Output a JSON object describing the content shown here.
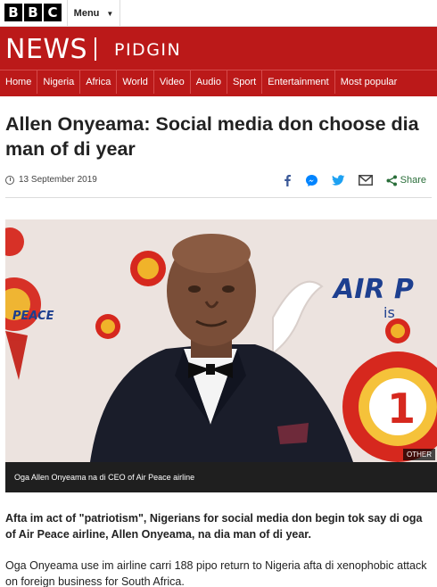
{
  "header": {
    "bbc_letters": [
      "B",
      "B",
      "C"
    ],
    "menu_label": "Menu",
    "news_label": "NEWS",
    "service_label": "PIDGIN"
  },
  "nav": {
    "items": [
      "Home",
      "Nigeria",
      "Africa",
      "World",
      "Video",
      "Audio",
      "Sport",
      "Entertainment",
      "Most popular"
    ]
  },
  "article": {
    "headline": "Allen Onyeama: Social media don choose dia man of di year",
    "date": "13 September 2019",
    "share_label": "Share",
    "image": {
      "credit": "OTHER",
      "caption": "Oga Allen Onyeama na di CEO of Air Peace airline",
      "backdrop_text_left": "PEACE",
      "backdrop_text_right": "AIR P",
      "backdrop_text_is": "is",
      "badge_number": "1"
    },
    "lead": "Afta im act of \"patriotism\", Nigerians for social media don begin tok say di oga of Air Peace airline, Allen Onyeama, na dia man of di year.",
    "paragraph": "Oga Onyeama use im airline carri 188 pipo return to Nigeria afta di xenophobic attack on foreign business for South Africa."
  },
  "colors": {
    "brand_red": "#bb1919",
    "share_green": "#2a6e3a",
    "facebook": "#3b5998",
    "messenger": "#0084ff",
    "twitter": "#1da1f2"
  },
  "icons": [
    "clock-icon",
    "facebook-icon",
    "messenger-icon",
    "twitter-icon",
    "email-icon",
    "share-icon",
    "chevron-down-icon"
  ]
}
